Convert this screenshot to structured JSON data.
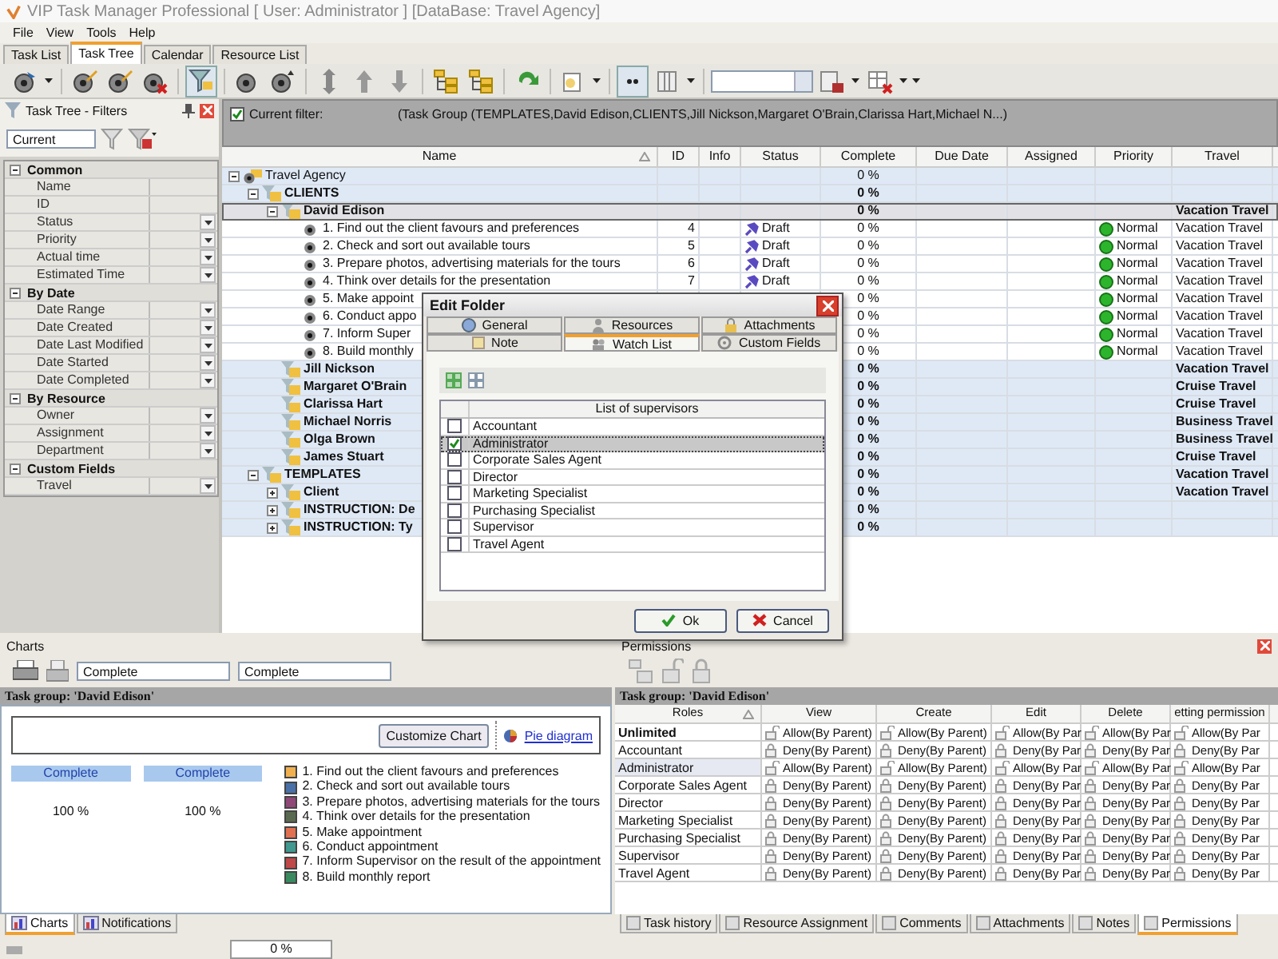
{
  "window": {
    "title": "VIP Task Manager Professional [ User: Administrator ] [DataBase: Travel Agency]"
  },
  "menu": [
    "File",
    "View",
    "Tools",
    "Help"
  ],
  "tabs": [
    {
      "label": "Task List",
      "selected": false
    },
    {
      "label": "Task Tree",
      "selected": true
    },
    {
      "label": "Calendar",
      "selected": false
    },
    {
      "label": "Resource List",
      "selected": false
    }
  ],
  "toolbar": [
    {
      "buttons": [
        {
          "kind": "disc-arrow",
          "pressed": false
        },
        {
          "kind": "caret",
          "pressed": false
        }
      ]
    },
    {
      "buttons": [
        {
          "kind": "disc-pencil",
          "pressed": false
        },
        {
          "kind": "disc-pencil",
          "pressed": false
        },
        {
          "kind": "disc-x",
          "pressed": false
        }
      ]
    },
    {
      "buttons": [
        {
          "kind": "funnel",
          "pressed": true
        }
      ]
    },
    {
      "buttons": [
        {
          "kind": "disc",
          "pressed": false
        },
        {
          "kind": "disc-up",
          "pressed": false
        }
      ]
    },
    {
      "buttons": [
        {
          "kind": "updown",
          "pressed": false
        },
        {
          "kind": "up",
          "pressed": false
        },
        {
          "kind": "down",
          "pressed": false
        }
      ]
    },
    {
      "buttons": [
        {
          "kind": "tree",
          "pressed": false
        },
        {
          "kind": "tree",
          "pressed": false
        }
      ]
    },
    {
      "buttons": [
        {
          "kind": "refresh",
          "pressed": false
        }
      ]
    },
    {
      "buttons": [
        {
          "kind": "page",
          "pressed": false
        },
        {
          "kind": "caret",
          "pressed": false
        }
      ]
    },
    {
      "buttons": [
        {
          "kind": "dots",
          "pressed": true
        },
        {
          "kind": "columns",
          "pressed": false
        },
        {
          "kind": "caret",
          "pressed": false
        }
      ]
    },
    {
      "buttons": [
        {
          "kind": "combo",
          "pressed": false
        },
        {
          "kind": "page-save",
          "pressed": false
        },
        {
          "kind": "caret",
          "pressed": false
        },
        {
          "kind": "grid-x",
          "pressed": false
        },
        {
          "kind": "caret",
          "pressed": false
        },
        {
          "kind": "caret",
          "pressed": false
        }
      ]
    }
  ],
  "filter_panel": {
    "title": "Task Tree - Filters",
    "preset": "Current",
    "groups": [
      {
        "name": "Common",
        "expanded": true,
        "items": [
          {
            "label": "Name",
            "dropdown": false
          },
          {
            "label": "ID",
            "dropdown": false
          },
          {
            "label": "Status",
            "dropdown": true
          },
          {
            "label": "Priority",
            "dropdown": true
          },
          {
            "label": "Actual time",
            "dropdown": true
          },
          {
            "label": "Estimated Time",
            "dropdown": true
          }
        ]
      },
      {
        "name": "By Date",
        "expanded": true,
        "items": [
          {
            "label": "Date Range",
            "dropdown": true
          },
          {
            "label": "Date Created",
            "dropdown": true
          },
          {
            "label": "Date Last Modified",
            "dropdown": true
          },
          {
            "label": "Date Started",
            "dropdown": true
          },
          {
            "label": "Date Completed",
            "dropdown": true
          }
        ]
      },
      {
        "name": "By Resource",
        "expanded": true,
        "items": [
          {
            "label": "Owner",
            "dropdown": true
          },
          {
            "label": "Assignment",
            "dropdown": true
          },
          {
            "label": "Department",
            "dropdown": true
          }
        ]
      },
      {
        "name": "Custom Fields",
        "expanded": true,
        "items": [
          {
            "label": "Travel",
            "dropdown": true
          }
        ]
      }
    ]
  },
  "filter_bar": {
    "label": "Current filter:",
    "enabled": true,
    "expression": "(Task Group  (TEMPLATES,David Edison,CLIENTS,Jill Nickson,Margaret O'Brain,Clarissa Hart,Michael N...)"
  },
  "grid": {
    "columns": [
      "Name",
      "ID",
      "Info",
      "Status",
      "Complete",
      "Due Date",
      "Assigned",
      "Priority",
      "Travel"
    ],
    "tree": [
      {
        "name": "Travel Agency",
        "kind": "root",
        "expanded": true,
        "selected": false,
        "complete": "0 %",
        "children": [
          {
            "name": "CLIENTS",
            "kind": "folder",
            "expanded": true,
            "selected": false,
            "complete": "0 %",
            "children": [
              {
                "name": "David Edison",
                "kind": "folder",
                "expanded": true,
                "selected": true,
                "complete": "0 %",
                "travel": "Vacation Travel",
                "children": [
                  {
                    "name": "1. Find out the client favours and preferences",
                    "kind": "task",
                    "selected": false,
                    "id": "4",
                    "status": "Draft",
                    "complete": "0 %",
                    "priority": "Normal",
                    "travel": "Vacation Travel"
                  },
                  {
                    "name": "2. Check and sort out available tours",
                    "kind": "task",
                    "selected": false,
                    "id": "5",
                    "status": "Draft",
                    "complete": "0 %",
                    "priority": "Normal",
                    "travel": "Vacation Travel"
                  },
                  {
                    "name": "3. Prepare photos, advertising materials for the tours",
                    "kind": "task",
                    "selected": false,
                    "id": "6",
                    "status": "Draft",
                    "complete": "0 %",
                    "priority": "Normal",
                    "travel": "Vacation Travel"
                  },
                  {
                    "name": "4. Think over details for the presentation",
                    "kind": "task",
                    "selected": false,
                    "id": "7",
                    "status": "Draft",
                    "complete": "0 %",
                    "priority": "Normal",
                    "travel": "Vacation Travel"
                  },
                  {
                    "name": "5. Make appoint",
                    "kind": "task",
                    "selected": false,
                    "complete": "0 %",
                    "priority": "Normal",
                    "travel": "Vacation Travel"
                  },
                  {
                    "name": "6. Conduct appo",
                    "kind": "task",
                    "selected": false,
                    "complete": "0 %",
                    "priority": "Normal",
                    "travel": "Vacation Travel"
                  },
                  {
                    "name": "7. Inform Super",
                    "kind": "task",
                    "selected": false,
                    "complete": "0 %",
                    "priority": "Normal",
                    "travel": "Vacation Travel"
                  },
                  {
                    "name": "8. Build monthly",
                    "kind": "task",
                    "selected": false,
                    "complete": "0 %",
                    "priority": "Normal",
                    "travel": "Vacation Travel"
                  }
                ]
              },
              {
                "name": "Jill Nickson",
                "kind": "folder",
                "selected": false,
                "complete": "0 %",
                "travel": "Vacation Travel"
              },
              {
                "name": "Margaret O'Brain",
                "kind": "folder",
                "selected": false,
                "complete": "0 %",
                "travel": "Cruise Travel"
              },
              {
                "name": "Clarissa Hart",
                "kind": "folder",
                "selected": false,
                "complete": "0 %",
                "travel": "Cruise Travel"
              },
              {
                "name": "Michael Norris",
                "kind": "folder",
                "selected": false,
                "complete": "0 %",
                "travel": "Business Travel"
              },
              {
                "name": "Olga Brown",
                "kind": "folder",
                "selected": false,
                "complete": "0 %",
                "travel": "Business Travel"
              },
              {
                "name": "James Stuart",
                "kind": "folder",
                "selected": false,
                "complete": "0 %",
                "travel": "Cruise Travel"
              }
            ]
          },
          {
            "name": "TEMPLATES",
            "kind": "folder",
            "expanded": true,
            "selected": false,
            "complete": "0 %",
            "travel": "Vacation Travel",
            "children": [
              {
                "name": "Client",
                "kind": "folder",
                "expanded": false,
                "selected": false,
                "complete": "0 %",
                "travel": "Vacation Travel"
              },
              {
                "name": "INSTRUCTION: De",
                "kind": "folder",
                "expanded": false,
                "selected": false,
                "complete": "0 %"
              },
              {
                "name": "INSTRUCTION: Ty",
                "kind": "folder",
                "expanded": false,
                "selected": false,
                "complete": "0 %"
              }
            ]
          }
        ]
      }
    ]
  },
  "dialog": {
    "title": "Edit Folder",
    "tab_rows": [
      {
        "tabs": [
          {
            "label": "General",
            "selected": false
          },
          {
            "label": "Resources",
            "selected": false
          },
          {
            "label": "Attachments",
            "selected": false
          }
        ]
      },
      {
        "tabs": [
          {
            "label": "Note",
            "selected": false
          },
          {
            "label": "Watch List",
            "selected": true
          },
          {
            "label": "Custom Fields",
            "selected": false
          }
        ]
      }
    ],
    "list_header": "List of supervisors",
    "supervisors": [
      {
        "name": "Accountant",
        "checked": false,
        "selected": false
      },
      {
        "name": "Administrator",
        "checked": true,
        "selected": true
      },
      {
        "name": "Corporate Sales Agent",
        "checked": false,
        "selected": false
      },
      {
        "name": "Director",
        "checked": false,
        "selected": false
      },
      {
        "name": "Marketing Specialist",
        "checked": false,
        "selected": false
      },
      {
        "name": "Purchasing Specialist",
        "checked": false,
        "selected": false
      },
      {
        "name": "Supervisor",
        "checked": false,
        "selected": false
      },
      {
        "name": "Travel Agent",
        "checked": false,
        "selected": false
      }
    ],
    "buttons": [
      {
        "label": "Ok",
        "kind": "ok"
      },
      {
        "label": "Cancel",
        "kind": "cancel"
      }
    ]
  },
  "charts_panel": {
    "title": "Charts",
    "selectors": [
      "Complete",
      "Complete"
    ],
    "group_title": "Task group: 'David Edison'",
    "customize_button": "Customize Chart",
    "pie_link": "Pie diagram",
    "columns": [
      {
        "header": "Complete",
        "value": "100 %"
      },
      {
        "header": "Complete",
        "value": "100 %"
      }
    ],
    "legend": [
      {
        "label": "1. Find out the client favours and preferences",
        "color": "#f0b050"
      },
      {
        "label": "2. Check and sort out available tours",
        "color": "#4a70a8"
      },
      {
        "label": "3. Prepare photos, advertising materials for the tours",
        "color": "#904878"
      },
      {
        "label": "4. Think over details for the presentation",
        "color": "#5a6a50"
      },
      {
        "label": "5. Make appointment",
        "color": "#e07050"
      },
      {
        "label": "6. Conduct appointment",
        "color": "#409890"
      },
      {
        "label": "7. Inform Supervisor on the result of the appointment",
        "color": "#c04848"
      },
      {
        "label": "8. Build monthly report",
        "color": "#3a8a60"
      }
    ],
    "tabs": [
      {
        "label": "Charts",
        "selected": true
      },
      {
        "label": "Notifications",
        "selected": false
      }
    ]
  },
  "permissions_panel": {
    "title": "Permissions",
    "group_title": "Task group: 'David Edison'",
    "columns": [
      "Roles",
      "View",
      "Create",
      "Edit",
      "Delete",
      "etting permission"
    ],
    "rows": [
      {
        "selected": false,
        "cells": [
          {
            "kind": "role",
            "text": "Unlimited",
            "bold": true
          },
          {
            "kind": "permission",
            "text": "Allow(By Parent)",
            "allow": true
          },
          {
            "kind": "permission",
            "text": "Allow(By Parent)",
            "allow": true
          },
          {
            "kind": "permission",
            "text": "Allow(By Par",
            "allow": true
          },
          {
            "kind": "permission",
            "text": "Allow(By Par",
            "allow": true
          },
          {
            "kind": "permission",
            "text": "Allow(By Par",
            "allow": true
          }
        ]
      },
      {
        "selected": false,
        "cells": [
          {
            "kind": "role",
            "text": "Accountant",
            "bold": false
          },
          {
            "kind": "permission",
            "text": "Deny(By Parent)",
            "allow": false
          },
          {
            "kind": "permission",
            "text": "Deny(By Parent)",
            "allow": false
          },
          {
            "kind": "permission",
            "text": "Deny(By Par",
            "allow": false
          },
          {
            "kind": "permission",
            "text": "Deny(By Par",
            "allow": false
          },
          {
            "kind": "permission",
            "text": "Deny(By Par",
            "allow": false
          }
        ]
      },
      {
        "selected": true,
        "cells": [
          {
            "kind": "role",
            "text": "Administrator",
            "bold": false
          },
          {
            "kind": "permission",
            "text": "Allow(By Parent)",
            "allow": true
          },
          {
            "kind": "permission",
            "text": "Allow(By Parent)",
            "allow": true
          },
          {
            "kind": "permission",
            "text": "Allow(By Par",
            "allow": true
          },
          {
            "kind": "permission",
            "text": "Allow(By Par",
            "allow": true
          },
          {
            "kind": "permission",
            "text": "Allow(By Par",
            "allow": true
          }
        ]
      },
      {
        "selected": false,
        "cells": [
          {
            "kind": "role",
            "text": "Corporate Sales Agent",
            "bold": false
          },
          {
            "kind": "permission",
            "text": "Deny(By Parent)",
            "allow": false
          },
          {
            "kind": "permission",
            "text": "Deny(By Parent)",
            "allow": false
          },
          {
            "kind": "permission",
            "text": "Deny(By Par",
            "allow": false
          },
          {
            "kind": "permission",
            "text": "Deny(By Par",
            "allow": false
          },
          {
            "kind": "permission",
            "text": "Deny(By Par",
            "allow": false
          }
        ]
      },
      {
        "selected": false,
        "cells": [
          {
            "kind": "role",
            "text": "Director",
            "bold": false
          },
          {
            "kind": "permission",
            "text": "Deny(By Parent)",
            "allow": false
          },
          {
            "kind": "permission",
            "text": "Deny(By Parent)",
            "allow": false
          },
          {
            "kind": "permission",
            "text": "Deny(By Par",
            "allow": false
          },
          {
            "kind": "permission",
            "text": "Deny(By Par",
            "allow": false
          },
          {
            "kind": "permission",
            "text": "Deny(By Par",
            "allow": false
          }
        ]
      },
      {
        "selected": false,
        "cells": [
          {
            "kind": "role",
            "text": "Marketing Specialist",
            "bold": false
          },
          {
            "kind": "permission",
            "text": "Deny(By Parent)",
            "allow": false
          },
          {
            "kind": "permission",
            "text": "Deny(By Parent)",
            "allow": false
          },
          {
            "kind": "permission",
            "text": "Deny(By Par",
            "allow": false
          },
          {
            "kind": "permission",
            "text": "Deny(By Par",
            "allow": false
          },
          {
            "kind": "permission",
            "text": "Deny(By Par",
            "allow": false
          }
        ]
      },
      {
        "selected": false,
        "cells": [
          {
            "kind": "role",
            "text": "Purchasing Specialist",
            "bold": false
          },
          {
            "kind": "permission",
            "text": "Deny(By Parent)",
            "allow": false
          },
          {
            "kind": "permission",
            "text": "Deny(By Parent)",
            "allow": false
          },
          {
            "kind": "permission",
            "text": "Deny(By Par",
            "allow": false
          },
          {
            "kind": "permission",
            "text": "Deny(By Par",
            "allow": false
          },
          {
            "kind": "permission",
            "text": "Deny(By Par",
            "allow": false
          }
        ]
      },
      {
        "selected": false,
        "cells": [
          {
            "kind": "role",
            "text": "Supervisor",
            "bold": false
          },
          {
            "kind": "permission",
            "text": "Deny(By Parent)",
            "allow": false
          },
          {
            "kind": "permission",
            "text": "Deny(By Parent)",
            "allow": false
          },
          {
            "kind": "permission",
            "text": "Deny(By Par",
            "allow": false
          },
          {
            "kind": "permission",
            "text": "Deny(By Par",
            "allow": false
          },
          {
            "kind": "permission",
            "text": "Deny(By Par",
            "allow": false
          }
        ]
      },
      {
        "selected": false,
        "cells": [
          {
            "kind": "role",
            "text": "Travel Agent",
            "bold": false
          },
          {
            "kind": "permission",
            "text": "Deny(By Parent)",
            "allow": false
          },
          {
            "kind": "permission",
            "text": "Deny(By Parent)",
            "allow": false
          },
          {
            "kind": "permission",
            "text": "Deny(By Par",
            "allow": false
          },
          {
            "kind": "permission",
            "text": "Deny(By Par",
            "allow": false
          },
          {
            "kind": "permission",
            "text": "Deny(By Par",
            "allow": false
          }
        ]
      }
    ],
    "tabs": [
      {
        "label": "Task history",
        "selected": false
      },
      {
        "label": "Resource Assignment",
        "selected": false
      },
      {
        "label": "Comments",
        "selected": false
      },
      {
        "label": "Attachments",
        "selected": false
      },
      {
        "label": "Notes",
        "selected": false
      },
      {
        "label": "Permissions",
        "selected": true
      }
    ]
  },
  "status_bar": {
    "progress_text": "0 %"
  }
}
